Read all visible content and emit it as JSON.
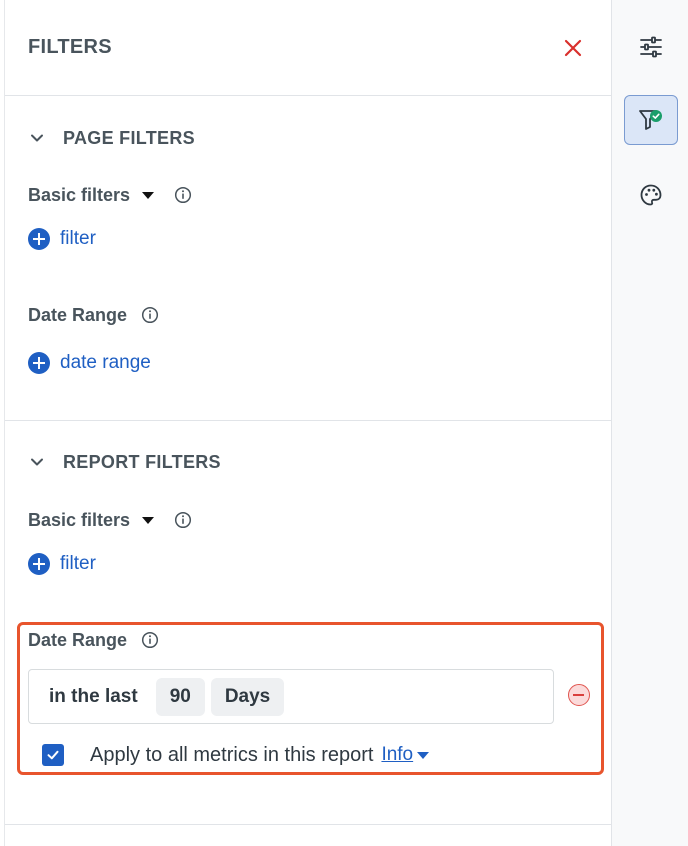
{
  "header": {
    "title": "FILTERS"
  },
  "page_filters": {
    "section_label": "PAGE FILTERS",
    "basic_filters_label": "Basic filters",
    "add_filter_label": "filter",
    "date_range_label": "Date Range",
    "add_date_range_label": "date range"
  },
  "report_filters": {
    "section_label": "REPORT FILTERS",
    "basic_filters_label": "Basic filters",
    "add_filter_label": "filter",
    "date_range_label": "Date Range",
    "date_range": {
      "prefix": "in the last",
      "amount": "90",
      "unit": "Days"
    },
    "apply_all_label": "Apply to all metrics in this report",
    "apply_all_checked": true,
    "info_label": "Info"
  },
  "rightbar": {
    "items": [
      "sliders-icon",
      "filter-check-icon",
      "palette-icon"
    ],
    "active": "filter-check-icon"
  },
  "colors": {
    "accent": "#1f5fc3",
    "close": "#d9302c",
    "highlight": "#e8542d",
    "check_badge": "#1a9e6a"
  }
}
